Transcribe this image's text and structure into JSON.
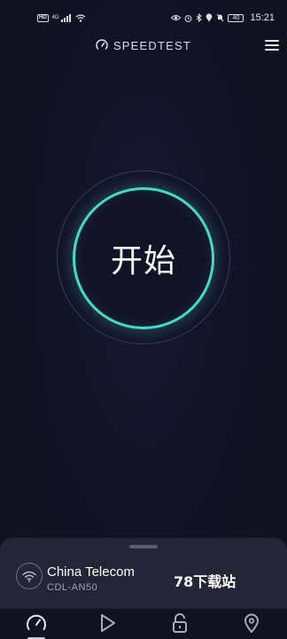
{
  "status_bar": {
    "hd": "HD",
    "network": "4G",
    "battery": "40",
    "time": "15:21"
  },
  "header": {
    "logo_text": "SPEEDTEST",
    "logo_icon": "speedometer-icon",
    "menu_icon": "hamburger-menu-icon"
  },
  "main": {
    "start_label": "开始"
  },
  "connection": {
    "isp": "China Telecom",
    "server": "CDL-AN50",
    "watermark": "78下载站",
    "icon": "wifi-icon"
  },
  "nav": {
    "items": [
      {
        "icon": "speed-gauge-icon",
        "active": true
      },
      {
        "icon": "play-icon",
        "active": false
      },
      {
        "icon": "unlock-icon",
        "active": false
      },
      {
        "icon": "location-pin-icon",
        "active": false
      }
    ]
  },
  "colors": {
    "background": "#11111f",
    "accent": "#47d9c7",
    "panel": "#242536"
  }
}
